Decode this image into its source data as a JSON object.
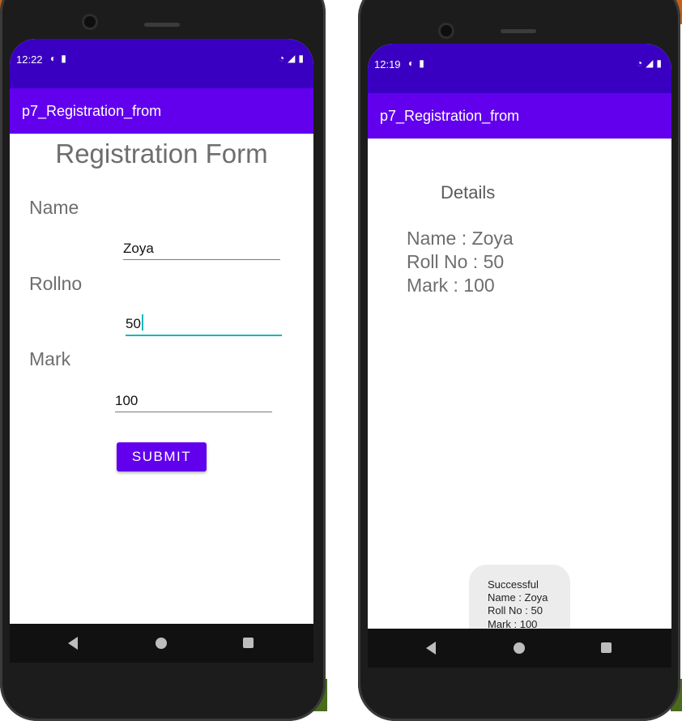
{
  "left_screen": {
    "status": {
      "time": "12:22"
    },
    "app_title": "p7_Registration_from",
    "form": {
      "title": "Registration Form",
      "name_label": "Name",
      "name_value": "Zoya",
      "rollno_label": "Rollno",
      "rollno_value": "50",
      "mark_label": "Mark",
      "mark_value": "100",
      "submit_label": "SUBMIT"
    }
  },
  "right_screen": {
    "status": {
      "time": "12:19"
    },
    "app_title": "p7_Registration_from",
    "details": {
      "title": "Details",
      "name_line": "Name : Zoya",
      "roll_line": "Roll No : 50",
      "mark_line": "Mark :  100"
    },
    "toast": {
      "line1": "Successful",
      "line2": "Name : Zoya",
      "line3": "Roll No : 50",
      "line4": "Mark :  100"
    }
  },
  "icons": {
    "status_left": [
      "app-notification-icon",
      "sd-card-icon"
    ],
    "status_right": [
      "wifi-icon",
      "signal-icon",
      "battery-icon"
    ],
    "nav": [
      "back-icon",
      "home-icon",
      "recents-icon"
    ]
  },
  "colors": {
    "status_bar": "#3a00c2",
    "app_bar": "#6200ee",
    "focus_accent": "#19b7b7",
    "button": "#6200ee"
  }
}
